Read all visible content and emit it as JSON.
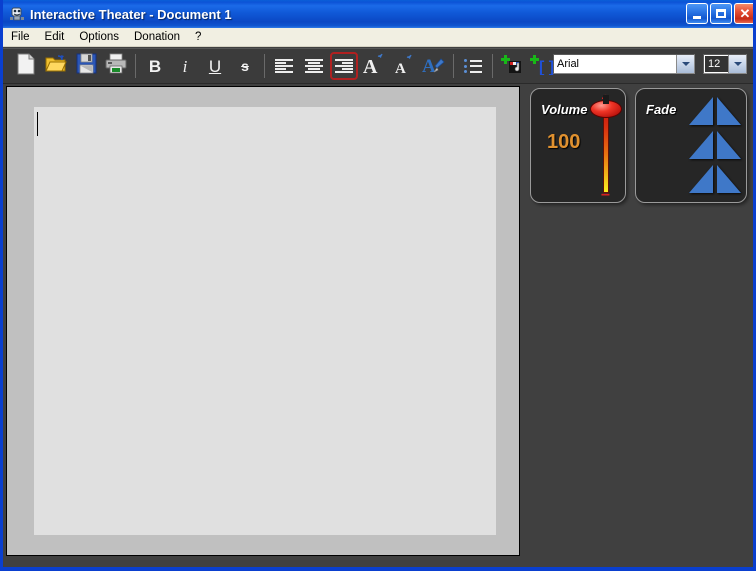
{
  "window": {
    "title": "Interactive Theater  - Document 1",
    "icon": "app-theater-icon",
    "titlebar_color": "#0c53d6",
    "background_color": "#404040",
    "border_color": "#0a3fcf"
  },
  "titlebar_buttons": [
    {
      "name": "minimize",
      "glyph": "_"
    },
    {
      "name": "maximize",
      "glyph": "□"
    },
    {
      "name": "close",
      "glyph": "✕"
    }
  ],
  "menubar": {
    "items": [
      {
        "label": "File"
      },
      {
        "label": "Edit"
      },
      {
        "label": "Options"
      },
      {
        "label": "Donation"
      },
      {
        "label": "?"
      }
    ]
  },
  "toolbar": {
    "background_color": "#3b3b3b",
    "active_border_color": "#b02020",
    "buttons": [
      {
        "name": "new-document",
        "icon": "new-file-icon",
        "label": "New",
        "active": false
      },
      {
        "name": "open-document",
        "icon": "open-folder-icon",
        "label": "Open",
        "active": false
      },
      {
        "name": "save-document",
        "icon": "save-floppy-icon",
        "label": "Save",
        "active": false
      },
      {
        "name": "print-document",
        "icon": "printer-icon",
        "label": "Print",
        "active": false
      },
      {
        "name": "bold",
        "icon": "bold-icon",
        "label": "B",
        "active": false
      },
      {
        "name": "italic",
        "icon": "italic-icon",
        "label": "i",
        "active": false
      },
      {
        "name": "underline",
        "icon": "underline-icon",
        "label": "U",
        "active": false
      },
      {
        "name": "strikethrough",
        "icon": "strikethrough-icon",
        "label": "s",
        "active": false
      },
      {
        "name": "align-left",
        "icon": "align-left-icon",
        "label": "Align Left",
        "active": false
      },
      {
        "name": "align-center",
        "icon": "align-center-icon",
        "label": "Align Center",
        "active": false
      },
      {
        "name": "align-right",
        "icon": "align-right-icon",
        "label": "Align Right",
        "active": true
      },
      {
        "name": "increase-font-size",
        "icon": "grow-font-icon",
        "label": "A",
        "active": false
      },
      {
        "name": "decrease-font-size",
        "icon": "shrink-font-icon",
        "label": "A",
        "active": false
      },
      {
        "name": "text-color",
        "icon": "paint-brush-a-icon",
        "label": "Text Color",
        "active": false
      },
      {
        "name": "bullet-list",
        "icon": "bullet-list-icon",
        "label": "Bullets",
        "active": false
      },
      {
        "name": "add-sound",
        "icon": "add-music-note-icon",
        "label": "Add Sound",
        "active": false
      },
      {
        "name": "add-tag",
        "icon": "add-bracket-icon",
        "label": "Add Tag",
        "active": false
      }
    ]
  },
  "font_controls": {
    "font_name": {
      "value": "Arial",
      "name": "font-name-combo"
    },
    "font_size": {
      "value": "12",
      "name": "font-size-combo"
    }
  },
  "document": {
    "name": "document-editor",
    "text": "",
    "page_color": "#e0e0e0",
    "frame_color": "#c0c0c0"
  },
  "panels": {
    "volume": {
      "title": "Volume",
      "value": "100",
      "value_color": "#e0912f",
      "plus_label": "+",
      "minus_label": "−",
      "slider_position_percent": 100
    },
    "fade": {
      "title": "Fade",
      "arrow_color": "#3f78c8",
      "rows": [
        {
          "name": "fade-row-1"
        },
        {
          "name": "fade-row-2"
        },
        {
          "name": "fade-row-3"
        }
      ]
    }
  }
}
